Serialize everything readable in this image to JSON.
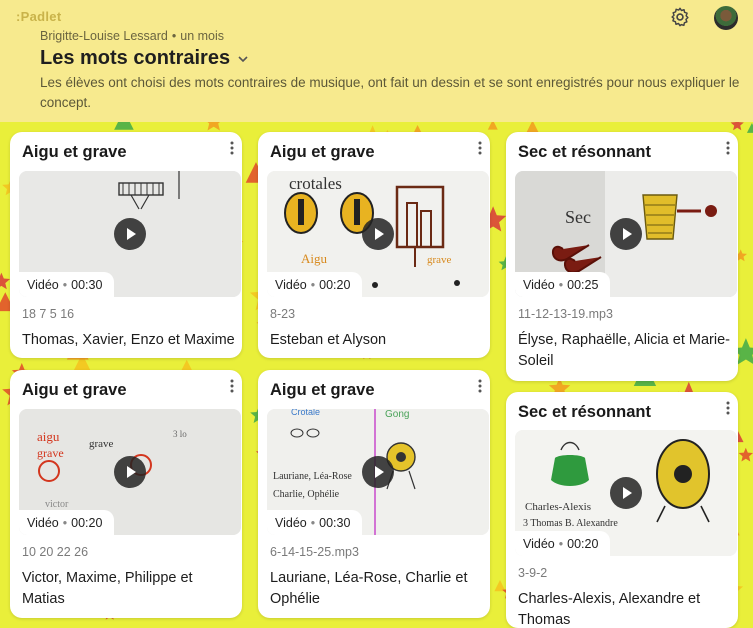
{
  "app": {
    "logo": ":Padlet"
  },
  "header": {
    "author": "Brigitte-Louise Lessard",
    "time": "un mois",
    "title": "Les mots contraires",
    "description": "Les élèves ont choisi des mots contraires de musique, ont fait un dessin et se sont enregistrés pour nous expliquer le concept."
  },
  "icons": {
    "settings": "gear-icon",
    "avatar": "user-avatar",
    "title_menu": "chevron-down-icon",
    "post_menu": "more-vertical-icon",
    "play": "play-icon"
  },
  "colors": {
    "header_bg": "#f7ea8e",
    "wall_bg": "#e9ef3a",
    "card_bg": "#ffffff"
  },
  "posts": [
    {
      "title": "Aigu et grave",
      "badge_type": "Vidéo",
      "duration": "00:30",
      "filename": "18 7 5 16",
      "names": "Thomas, Xavier, Enzo et Maxime"
    },
    {
      "title": "Aigu et grave",
      "badge_type": "Vidéo",
      "duration": "00:20",
      "filename": "8-23",
      "names": "Esteban et Alyson"
    },
    {
      "title": "Sec et résonnant",
      "badge_type": "Vidéo",
      "duration": "00:25",
      "filename": "11-12-13-19.mp3",
      "names": "Élyse, Raphaëlle, Alicia et Marie-Soleil"
    },
    {
      "title": "Aigu et grave",
      "badge_type": "Vidéo",
      "duration": "00:20",
      "filename": "10   20  22  26",
      "names": "Victor, Maxime, Philippe et Matias"
    },
    {
      "title": "Aigu et grave",
      "badge_type": "Vidéo",
      "duration": "00:30",
      "filename": "6-14-15-25.mp3",
      "names": "Lauriane, Léa-Rose, Charlie et Ophélie"
    },
    {
      "title": "Sec et résonnant",
      "badge_type": "Vidéo",
      "duration": "00:20",
      "filename": "3-9-2",
      "names": "Charles-Alexis, Alexandre et Thomas"
    }
  ]
}
